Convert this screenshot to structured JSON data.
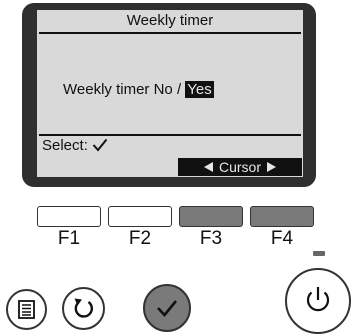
{
  "screen": {
    "title": "Weekly timer",
    "setting_label": "Weekly timer",
    "option_no": "No",
    "option_separator": "/",
    "option_yes": "Yes",
    "selected_option": "Yes",
    "select_label": "Select:",
    "select_icon": "check-icon",
    "cursor_label": "Cursor",
    "cursor_icons": [
      "cursor-left-icon",
      "cursor-right-icon"
    ]
  },
  "function_keys": [
    {
      "label": "F1",
      "state": "inactive"
    },
    {
      "label": "F2",
      "state": "inactive"
    },
    {
      "label": "F3",
      "state": "active"
    },
    {
      "label": "F4",
      "state": "active"
    }
  ],
  "buttons": {
    "menu_icon": "menu-icon",
    "return_icon": "return-icon",
    "confirm_icon": "check-icon",
    "power_icon": "power-icon"
  },
  "colors": {
    "bezel": "#2f2f2f",
    "lcd_background": "#d9d9d9",
    "lcd_text": "#111111",
    "active_key": "#7a7a7a"
  }
}
